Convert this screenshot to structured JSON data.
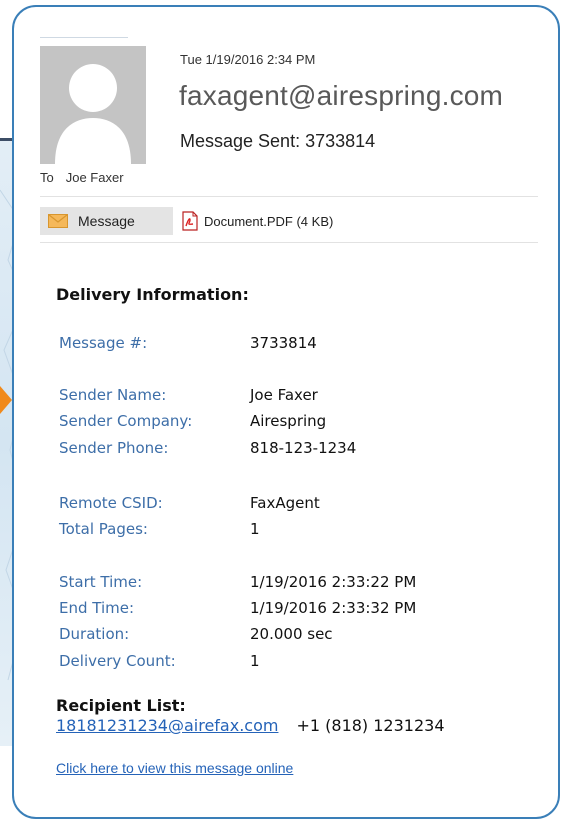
{
  "email": {
    "date": "Tue 1/19/2016 2:34 PM",
    "from": "faxagent@airespring.com",
    "subject": "Message Sent: 3733814",
    "to_label": "To",
    "to_name": "Joe Faxer"
  },
  "tabs": {
    "message_label": "Message",
    "attachment_label": "Document.PDF (4 KB)"
  },
  "body": {
    "section_title": "Delivery Information:",
    "fields": [
      {
        "label": "Message #:",
        "value": "3733814"
      },
      {
        "label": "Sender Name:",
        "value": "Joe Faxer"
      },
      {
        "label": "Sender Company:",
        "value": "Airespring"
      },
      {
        "label": "Sender Phone:",
        "value": "818-123-1234"
      },
      {
        "label": "Remote CSID:",
        "value": "FaxAgent"
      },
      {
        "label": "Total Pages:",
        "value": "1"
      },
      {
        "label": "Start Time:",
        "value": "1/19/2016 2:33:22 PM"
      },
      {
        "label": "End Time:",
        "value": "1/19/2016 2:33:32 PM"
      },
      {
        "label": "Duration:",
        "value": "20.000 sec"
      },
      {
        "label": "Delivery Count:",
        "value": "1"
      }
    ],
    "recipient_title": "Recipient List:",
    "recipient_email": "18181231234@airefax.com",
    "recipient_phone": "+1 (818) 1231234",
    "view_online": "Click here to view this message online"
  },
  "icons": {
    "avatar": "person-silhouette-icon",
    "message": "envelope-icon",
    "attachment": "pdf-file-icon"
  },
  "colors": {
    "border": "#3a7fb8",
    "label": "#3d6ea8",
    "link": "#2563b8",
    "arrow": "#f08a1c"
  }
}
